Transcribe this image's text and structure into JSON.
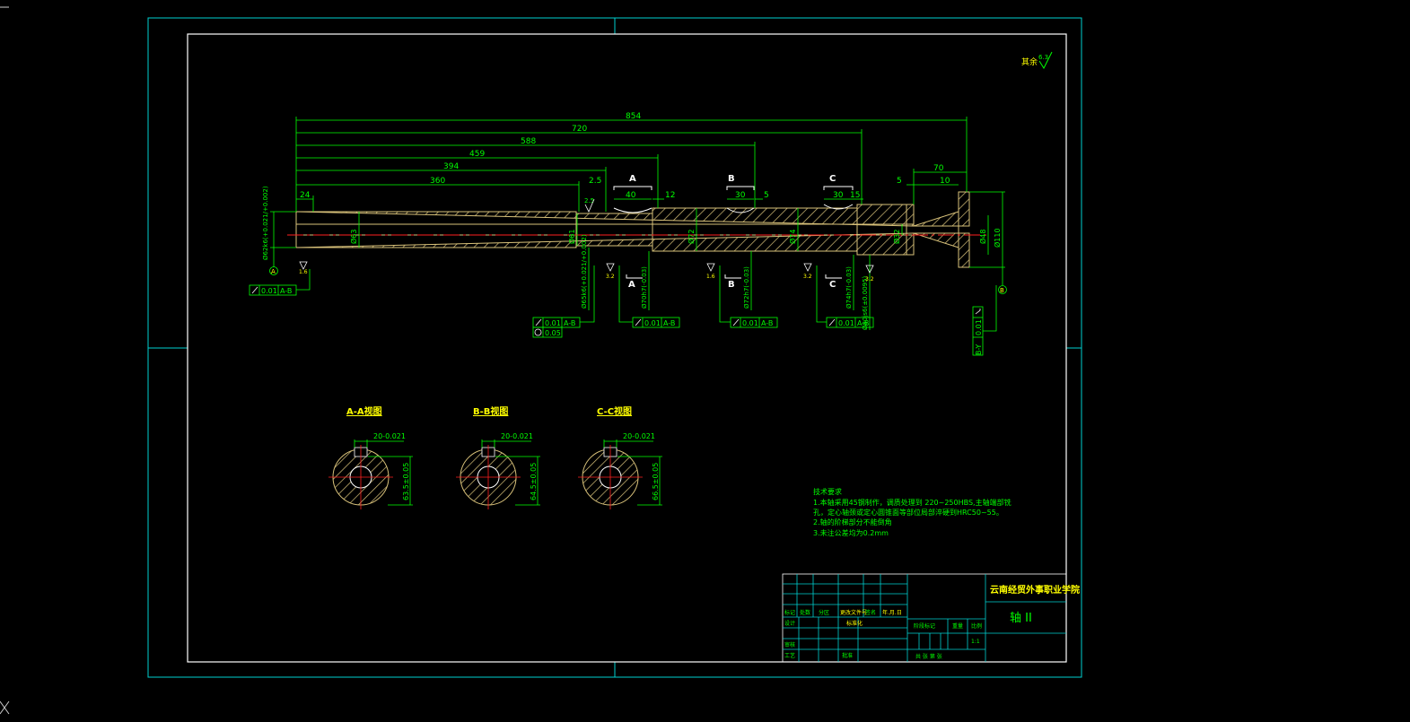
{
  "colors": {
    "frame": "#00d0d0",
    "dim": "#00ff00",
    "shaft": "#d9c27a",
    "center": "#ff2020",
    "text": "#00ff00",
    "yellow": "#ffff00"
  },
  "top": {
    "roughness_label": "其余",
    "roughness_value": "6.3"
  },
  "dims": {
    "d854": "854",
    "d720": "720",
    "d588": "588",
    "d459": "459",
    "d394": "394",
    "d360": "360",
    "d24": "24",
    "d25": "2.5",
    "d40": "40",
    "d12": "12",
    "d30a": "30",
    "d5a": "5",
    "d30b": "30",
    "d15": "15",
    "d5b": "5",
    "d70": "70",
    "d10": "10",
    "secA": "A",
    "secB": "B",
    "secC": "C",
    "secA2": "A",
    "secB2": "B",
    "secC2": "C",
    "small25": "2.5"
  },
  "diameters": {
    "phi63": "Ø63",
    "phi61": "Ø61",
    "phi72": "Ø72",
    "phi74": "Ø74",
    "phi32": "Ø32",
    "phi48": "Ø48",
    "phi110": "Ø110",
    "left_fit": "Ø62k6(+0.021/+0.002)",
    "fit_a": "Ø65k6(+0.021/+0.002)",
    "fit_b": "Ø70h7(-0.03)",
    "fit_c": "Ø72h7(-0.03)",
    "fit_d": "Ø74h7(-0.03)",
    "fit_e": "Ø80js6(±0.0095)"
  },
  "tolerances": {
    "left": {
      "value": "0.01",
      "datum": "A-B"
    },
    "t1": {
      "value": "0.01",
      "datum": "A-B"
    },
    "t1b": {
      "value": "0.05"
    },
    "t2": {
      "value": "0.01",
      "datum": "A-B"
    },
    "t3": {
      "value": "0.01",
      "datum": "A-B"
    },
    "t4": {
      "value": "0.01",
      "datum": "A-B"
    },
    "right_value": "0.01",
    "right_datum": "B-Y"
  },
  "datums": {
    "a": "A",
    "b": "B"
  },
  "rough_marks": [
    "1.6",
    "3.2",
    "1.6",
    "3.2",
    "3.2",
    "1.6",
    "3.2",
    "3.2"
  ],
  "sections": [
    {
      "title": "A-A视图",
      "key": "20-0.021",
      "depth": "63.5±0.05"
    },
    {
      "title": "B-B视图",
      "key": "20-0.021",
      "depth": "64.5±0.05"
    },
    {
      "title": "C-C视图",
      "key": "20-0.021",
      "depth": "66.5±0.05"
    }
  ],
  "notes": {
    "title": "技术要求",
    "lines": [
      "1.本轴采用45钢制作，调质处理到 220~250HBS,主轴端部铣",
      "孔，定心轴颈或定心圆锥面等部位局部淬硬到HRC50~55。",
      "2.轴的阶梯部分不能倒角",
      "3.未注公差均为0.2mm"
    ]
  },
  "title_block": {
    "school": "云南经贸外事职业学院",
    "part": "轴 II",
    "labels": {
      "r1": "标记",
      "r2": "处数",
      "r3": "分区",
      "r4": "更改文件号",
      "r5": "签名",
      "r6": "年.月.日",
      "design": "设计",
      "standard": "标准化",
      "stage": "阶段标记",
      "weight": "重量",
      "scale": "比例",
      "scale_val": "1:1",
      "check": "审核",
      "craft": "工艺",
      "approve": "批准",
      "sheet": "共  张  第  张"
    }
  }
}
